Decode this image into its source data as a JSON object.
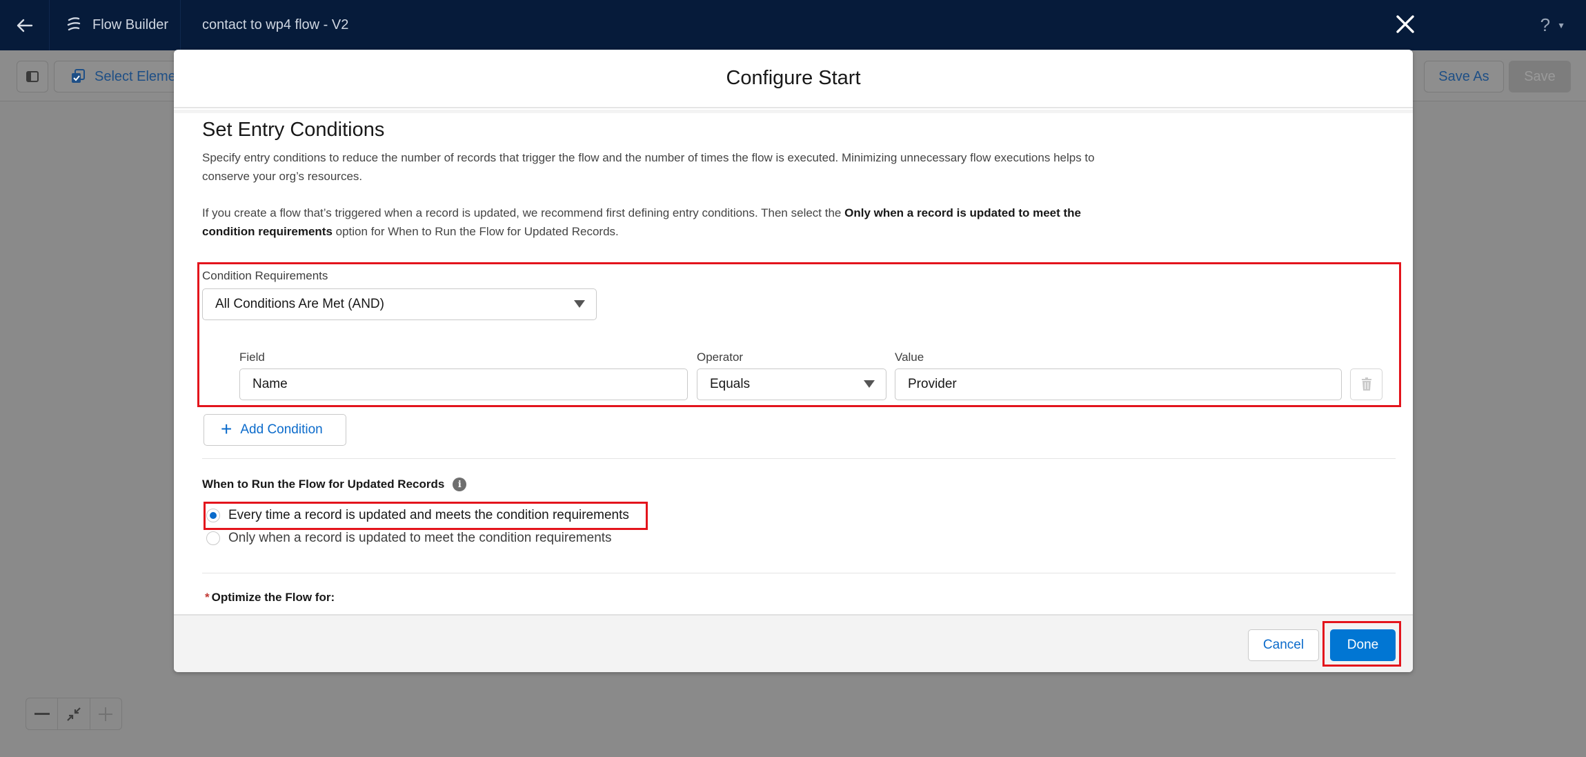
{
  "topnav": {
    "app_name": "Flow Builder",
    "flow_title": "contact to wp4 flow - V2",
    "help_label": "?",
    "icons": {
      "back": "arrow-left-icon",
      "logo": "flow-builder-logo-icon",
      "help_caret": "caret-down-icon"
    }
  },
  "toolbar": {
    "select_elements_label": "Select Elements",
    "save_as_label": "Save As",
    "save_label": "Save",
    "save_disabled": true
  },
  "canvas_controls": {
    "zoom_out_label": "—",
    "fit_label": "fit-to-view",
    "zoom_in_label": "+"
  },
  "modal": {
    "title": "Configure Start",
    "close_icon": "close-icon",
    "section_title": "Set Entry Conditions",
    "description": "Specify entry conditions to reduce the number of records that trigger the flow and the number of times the flow is executed. Minimizing unnecessary flow executions helps to conserve your org’s resources.",
    "recommendation": {
      "before": "If you create a flow that’s triggered when a record is updated, we recommend first defining entry conditions. Then select the ",
      "bold": "Only when a record is updated to meet the condition requirements",
      "after": " option for When to Run the Flow for Updated Records."
    },
    "condition_requirements": {
      "label": "Condition Requirements",
      "value": "All Conditions Are Met (AND)"
    },
    "conditions": [
      {
        "field_label": "Field",
        "field_value": "Name",
        "operator_label": "Operator",
        "operator_value": "Equals",
        "value_label": "Value",
        "value_value": "Provider"
      }
    ],
    "add_condition_label": "Add Condition",
    "when_to_run": {
      "label": "When to Run the Flow for Updated Records",
      "info_icon": "i",
      "options": [
        {
          "label": "Every time a record is updated and meets the condition requirements",
          "selected": true
        },
        {
          "label": "Only when a record is updated to meet the condition requirements",
          "selected": false
        }
      ]
    },
    "optimize": {
      "required_marker": "*",
      "label": "Optimize the Flow for:"
    },
    "footer": {
      "cancel_label": "Cancel",
      "done_label": "Done"
    }
  },
  "annotations": {
    "highlight_color": "#e3141c",
    "highlighted": [
      "condition-requirements-block",
      "radio-every-time",
      "done-button"
    ]
  },
  "colors": {
    "nav_bg": "#061b3a",
    "brand_blue": "#0176d3",
    "link_blue": "#0b6bcb",
    "overlay_gray": "#8a8a8a"
  }
}
